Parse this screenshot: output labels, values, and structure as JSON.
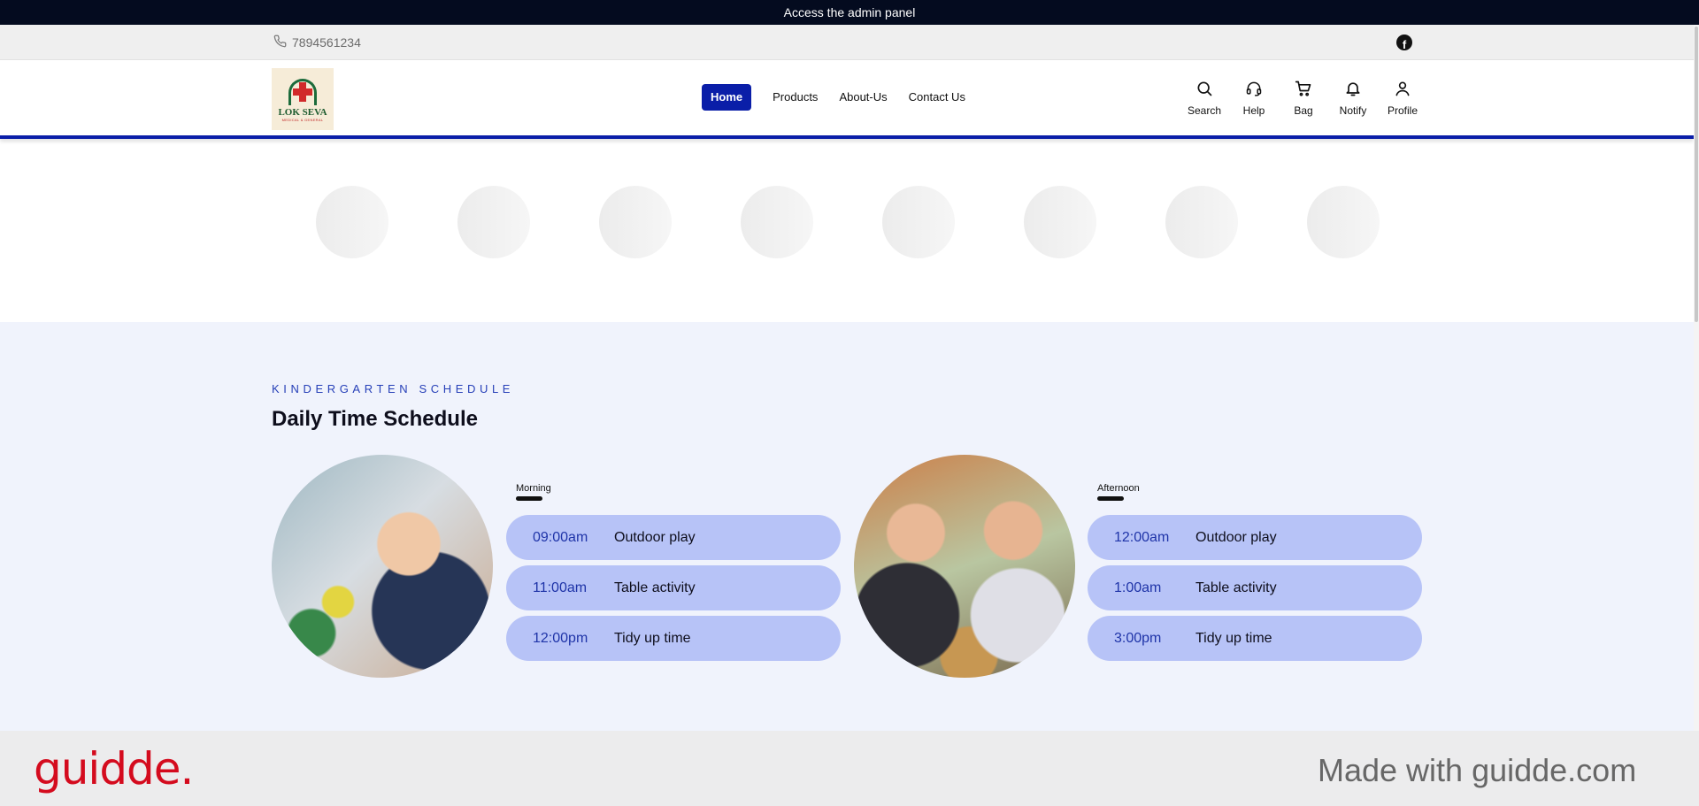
{
  "announcement": {
    "text": "Access the admin panel"
  },
  "contact": {
    "phone": "7894561234",
    "phone_icon": "phone-icon",
    "social_icon": "facebook-icon",
    "social_glyph": "f"
  },
  "logo": {
    "name": "LOK SEVA",
    "sub": "MEDICAL & GENERAL"
  },
  "nav": {
    "items": [
      {
        "label": "Home",
        "active": true
      },
      {
        "label": "Products"
      },
      {
        "label": "About-Us"
      },
      {
        "label": "Contact Us"
      }
    ]
  },
  "actions": [
    {
      "label": "Search",
      "icon": "search-icon"
    },
    {
      "label": "Help",
      "icon": "headset-icon"
    },
    {
      "label": "Bag",
      "icon": "cart-icon"
    },
    {
      "label": "Notify",
      "icon": "bell-icon"
    },
    {
      "label": "Profile",
      "icon": "user-icon"
    }
  ],
  "categories": {
    "count": 8
  },
  "schedule": {
    "eyebrow": "KINDERGARTEN SCHEDULE",
    "title": "Daily Time Schedule",
    "morning": {
      "label": "Morning",
      "rows": [
        {
          "time": "09:00am",
          "activity": "Outdoor play"
        },
        {
          "time": "11:00am",
          "activity": "Table activity"
        },
        {
          "time": "12:00pm",
          "activity": "Tidy up time"
        }
      ]
    },
    "afternoon": {
      "label": "Afternoon",
      "rows": [
        {
          "time": "12:00am",
          "activity": "Outdoor play"
        },
        {
          "time": "1:00am",
          "activity": "Table activity"
        },
        {
          "time": "3:00pm",
          "activity": "Tidy up time"
        }
      ]
    }
  },
  "footer": {
    "brand": "guidde.",
    "tagline": "Made with guidde.com"
  },
  "colors": {
    "accent": "#0a1ea8",
    "row_bg": "#b7c3f7",
    "brand_red": "#d40b1e",
    "section_bg": "#f0f3fc"
  }
}
